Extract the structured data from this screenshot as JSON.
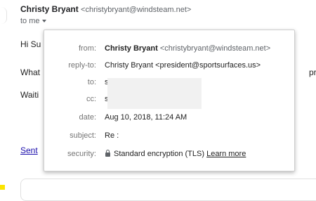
{
  "header": {
    "sender_name": "Christy Bryant",
    "sender_email": "<christybryant@windsteam.net>",
    "to_label": "to me"
  },
  "body": {
    "line1": "Hi Su",
    "line2": "What",
    "line3": "Waiti",
    "right_clip": "proc",
    "sent_link": "Sent"
  },
  "details": {
    "from": {
      "label": "from:",
      "name": "Christy Bryant",
      "email": "<christybryant@windsteam.net>"
    },
    "reply_to": {
      "label": "reply-to:",
      "value": "Christy Bryant <president@sportsurfaces.us>"
    },
    "to": {
      "label": "to:",
      "value": "s"
    },
    "cc": {
      "label": "cc:",
      "value": "s"
    },
    "date": {
      "label": "date:",
      "value": "Aug 10, 2018, 11:24 AM"
    },
    "subject": {
      "label": "subject:",
      "value": "Re :"
    },
    "security": {
      "label": "security:",
      "value": "Standard encryption (TLS)",
      "link": "Learn more"
    }
  },
  "icons": {
    "caret": "chevron-down-icon",
    "lock": "lock-icon"
  },
  "colors": {
    "link": "#1a0dab",
    "label": "#757575"
  }
}
